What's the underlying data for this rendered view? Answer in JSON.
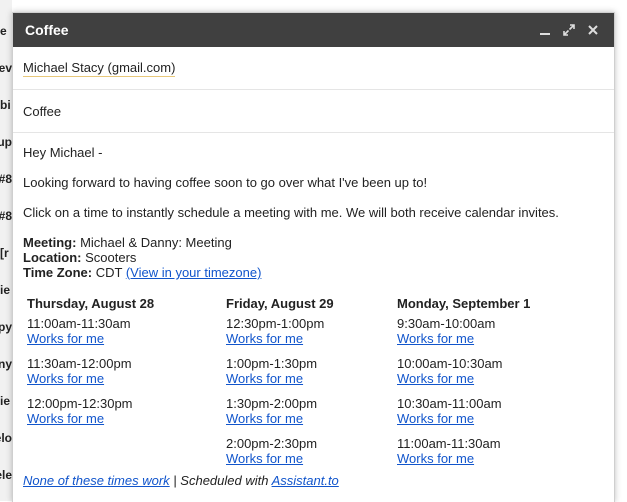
{
  "window": {
    "title": "Coffee"
  },
  "background_fragments": [
    "e",
    "ev",
    "bi",
    "up",
    "#8",
    "#8",
    "r]",
    "ie",
    "py",
    "any",
    "ie",
    "elo",
    "ele"
  ],
  "recipient": "Michael Stacy (gmail.com)",
  "subject": "Coffee",
  "body": {
    "greeting": "Hey Michael -",
    "line1": "Looking forward to having coffee soon to go over what I've been up to!",
    "line2": "Click on a time to instantly schedule a meeting with me. We will both receive calendar invites.",
    "meeting_label": "Meeting:",
    "meeting_value": " Michael & Danny: Meeting",
    "location_label": "Location:",
    "location_value": " Scooters",
    "timezone_label": "Time Zone:",
    "timezone_value": " CDT ",
    "timezone_link": "(View in your timezone)"
  },
  "schedule": [
    {
      "day": "Thursday, August 28",
      "slots": [
        {
          "time": "11:00am-11:30am",
          "link": "Works for me"
        },
        {
          "time": "11:30am-12:00pm",
          "link": "Works for me"
        },
        {
          "time": "12:00pm-12:30pm",
          "link": "Works for me"
        }
      ]
    },
    {
      "day": "Friday, August 29",
      "slots": [
        {
          "time": "12:30pm-1:00pm",
          "link": "Works for me"
        },
        {
          "time": "1:00pm-1:30pm",
          "link": "Works for me"
        },
        {
          "time": "1:30pm-2:00pm",
          "link": "Works for me"
        },
        {
          "time": "2:00pm-2:30pm",
          "link": "Works for me"
        }
      ]
    },
    {
      "day": "Monday, September 1",
      "slots": [
        {
          "time": "9:30am-10:00am",
          "link": "Works for me"
        },
        {
          "time": "10:00am-10:30am",
          "link": "Works for me"
        },
        {
          "time": "10:30am-11:00am",
          "link": "Works for me"
        },
        {
          "time": "11:00am-11:30am",
          "link": "Works for me"
        }
      ]
    }
  ],
  "footer": {
    "none_link": "None of these times work",
    "separator": " | Scheduled with ",
    "assistant_link": "Assistant.to"
  },
  "icons": {
    "minimize": "minimize-icon",
    "popout": "popout-icon",
    "close": "close-icon"
  },
  "colors": {
    "titlebar": "#404040",
    "link": "#1155cc",
    "recipient_underline": "#e8c87a"
  }
}
